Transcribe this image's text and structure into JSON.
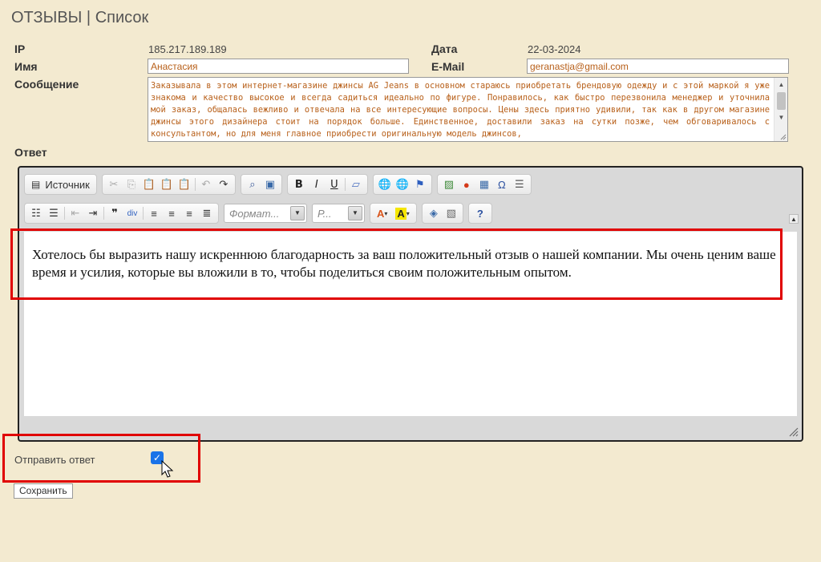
{
  "page": {
    "title": "ОТЗЫВЫ | Список"
  },
  "fields": {
    "ip_label": "IP",
    "ip_value": "185.217.189.189",
    "date_label": "Дата",
    "date_value": "22-03-2024",
    "name_label": "Имя",
    "name_value": "Анастасия",
    "email_label": "E-Mail",
    "email_value": "geranastja@gmail.com",
    "message_label": "Сообщение",
    "message_value": "Заказывала в этом интернет-магазине джинсы AG Jeans в основном стараюсь приобретать брендовую одежду и с этой маркой я уже знакома и качество высокое и всегда садиться идеально по фигуре. Понравилось, как быстро перезвонила менеджер и уточнила мой заказ, общалась вежливо и отвечала на все интересующие вопросы. Цены здесь приятно удивили, так как в другом магазине джинсы этого дизайнера стоит на порядок больше. Единственное, доставили заказ на сутки позже, чем обговаривалось с консультантом, но для меня главное приобрести оригинальную модель джинсов,",
    "reply_label": "Ответ"
  },
  "editor": {
    "toolbar": {
      "source_label": "Источник",
      "format_placeholder": "Формат...",
      "size_placeholder": "Р..."
    },
    "content": "Хотелось бы выразить нашу искреннюю благодарность за ваш положительный отзыв о нашей компании. Мы очень ценим ваше время и усилия, которые вы вложили в то, чтобы поделиться своим положительным опытом."
  },
  "send": {
    "label": "Отправить ответ",
    "checked": true
  },
  "save_button": "Сохранить",
  "colors": {
    "highlight": "#e00000",
    "background": "#f3ead0",
    "field_text": "#b8601a",
    "checkbox": "#1a73e8"
  }
}
